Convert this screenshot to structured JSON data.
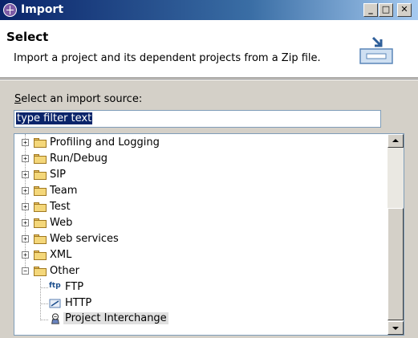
{
  "window": {
    "title": "Import"
  },
  "header": {
    "title": "Select",
    "description": "Import a project and its dependent projects from a Zip file."
  },
  "source": {
    "label_prefix": "S",
    "label_rest": "elect an import source:",
    "filter_value": "type filter text"
  },
  "tree": {
    "folders": [
      {
        "label": "Profiling and Logging",
        "expanded": false
      },
      {
        "label": "Run/Debug",
        "expanded": false
      },
      {
        "label": "SIP",
        "expanded": false
      },
      {
        "label": "Team",
        "expanded": false
      },
      {
        "label": "Test",
        "expanded": false
      },
      {
        "label": "Web",
        "expanded": false
      },
      {
        "label": "Web services",
        "expanded": false
      },
      {
        "label": "XML",
        "expanded": false
      },
      {
        "label": "Other",
        "expanded": true
      }
    ],
    "other_children": [
      {
        "label": "FTP",
        "icon": "ftp-icon",
        "icon_text": "ftp"
      },
      {
        "label": "HTTP",
        "icon": "http-icon",
        "icon_text": ""
      },
      {
        "label": "Project Interchange",
        "icon": "project-interchange-icon",
        "icon_text": "",
        "selected": true
      }
    ]
  }
}
